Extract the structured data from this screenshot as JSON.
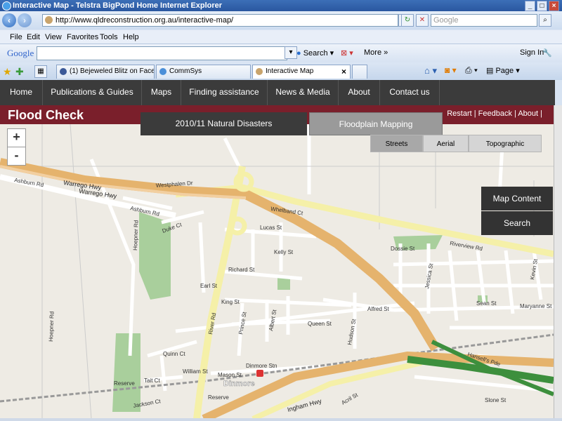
{
  "window": {
    "title": "Interactive Map - Telstra BigPond Home Internet Explorer"
  },
  "address": {
    "url": "http://www.qldreconstruction.org.au/interactive-map/",
    "search_placeholder": "Google"
  },
  "menu": [
    "File",
    "Edit",
    "View",
    "Favorites",
    "Tools",
    "Help"
  ],
  "google_toolbar": {
    "logo": "Google",
    "search_label": "Search",
    "more_label": "More",
    "signin_label": "Sign In"
  },
  "tabs": [
    {
      "label": "(1) Bejeweled Blitz on Facebo..."
    },
    {
      "label": "CommSys"
    },
    {
      "label": "Interactive Map"
    }
  ],
  "ie_toolbar": {
    "page_label": "Page"
  },
  "site_nav": [
    "Home",
    "Publications & Guides",
    "Maps",
    "Finding assistance",
    "News & Media",
    "About",
    "Contact us"
  ],
  "flood_check": {
    "title": "Flood Check",
    "links": "Restart  |  Feedback  |  About  |"
  },
  "map_tabs": [
    "2010/11 Natural Disasters",
    "Floodplain Mapping"
  ],
  "layer_buttons": [
    "Streets",
    "Aerial",
    "Topographic"
  ],
  "zoom": {
    "in": "+",
    "out": "-"
  },
  "side_buttons": [
    "Map Content",
    "Search"
  ],
  "map_labels": {
    "warrego1": "Warrego Hwy",
    "warrego2": "Warrego Hwy",
    "ashburn": "Ashburn Rd",
    "ashburn2": "Ashburn Rd",
    "westphalen": "Westphalen Dr",
    "whelband": "Whelband Ct",
    "riverview": "Riverview Rd",
    "duke": "Duke Ct",
    "lucas": "Lucas St",
    "kelly": "Kelly St",
    "richard": "Richard St",
    "earl": "Earl St",
    "king": "King St",
    "river": "River Rd",
    "queen": "Queen St",
    "alfred": "Alfred St",
    "hudson": "Hudson St",
    "quinn": "Quinn Ct",
    "william": "William St",
    "mason": "Mason St",
    "dinmore_stn": "Dinmore Stn",
    "dinmore": "Dinmore",
    "reserve": "Reserve",
    "jackson": "Jackson Ct",
    "hoepner": "Hoepner Rd",
    "dossie": "Dossie St",
    "jessica": "Jessica St",
    "sean": "Sean St",
    "maryanne": "Maryanne St",
    "hansell": "Hansell's Pde",
    "slone": "Slone St",
    "acril": "Acril St",
    "prince": "Prince St",
    "albert": "Albert St",
    "tait": "Tait Ct",
    "kevin": "Kevin St",
    "ingham": "Ingham Hwy"
  },
  "colors": {
    "nav_bg": "#3b3b3b",
    "flood_bar": "#7a1f2b",
    "highway": "#e5b36d",
    "flood": "#3d8f3d"
  }
}
